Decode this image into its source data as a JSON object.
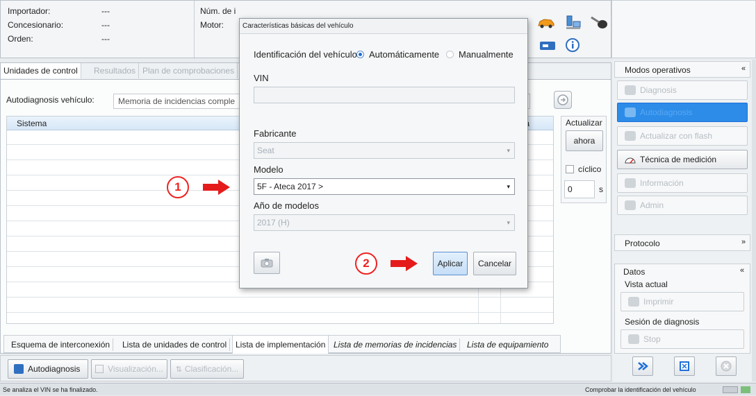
{
  "header": {
    "importador_label": "Importador:",
    "importador_value": "---",
    "concesionario_label": "Concesionario:",
    "concesionario_value": "---",
    "orden_label": "Orden:",
    "orden_value": "---",
    "num_ident_label": "Núm. de i",
    "num_ident_suffix": "...",
    "motor_label": "Motor:"
  },
  "tabs": [
    "Unidades de control",
    "Resultados",
    "Plan de comprobaciones"
  ],
  "autodiag": {
    "label": "Autodiagnosis vehículo:",
    "select_value": "Memoria de incidencias comple"
  },
  "table": {
    "col_sistema": "Sistema",
    "col_incidencia": "ncia"
  },
  "actualizar": {
    "title": "Actualizar",
    "ahora": "ahora",
    "ciclico": "cíclico",
    "interval_value": "0",
    "unit": "s"
  },
  "bottom_tabs": [
    "Esquema de interconexión",
    "Lista de unidades de control",
    "Lista de implementación",
    "Lista de memorias de incidencias",
    "Lista de equipamiento"
  ],
  "toolbar": {
    "autodiagnosis": "Autodiagnosis",
    "visualizacion": "Visualización...",
    "clasificacion": "Clasificación..."
  },
  "status_left": "Se analiza el VIN se ha finalizado.",
  "status_right": "Comprobar la identificación del vehículo",
  "sidebar": {
    "modos_title": "Modos operativos",
    "modos": [
      "Diagnosis",
      "Autodiagnosis",
      "Actualizar con flash",
      "Técnica de medición",
      "Información",
      "Admin"
    ],
    "protocolo_title": "Protocolo",
    "datos_title": "Datos",
    "vista_actual": "Vista actual",
    "imprimir": "Imprimir",
    "sesion": "Sesión de diagnosis",
    "stop": "Stop",
    "collapse_up": "«",
    "collapse_down": "»"
  },
  "dialog": {
    "title": "Características básicas del vehículo",
    "ident_label": "Identificación del vehículo",
    "auto_label": "Automáticamente",
    "manual_label": "Manualmente",
    "vin_label": "VIN",
    "vin_value": "",
    "fabricante_label": "Fabricante",
    "fabricante_value": "Seat",
    "modelo_label": "Modelo",
    "modelo_value": "5F - Ateca 2017 >",
    "anio_label": "Año de modelos",
    "anio_value": "2017 (H)",
    "aplicar": "Aplicar",
    "cancelar": "Cancelar"
  },
  "annotations": {
    "one": "1",
    "two": "2"
  },
  "colors": {
    "accent": "#1e6fd9",
    "arrow": "#e51b1b",
    "selected_mode": "#cfe4fb"
  }
}
